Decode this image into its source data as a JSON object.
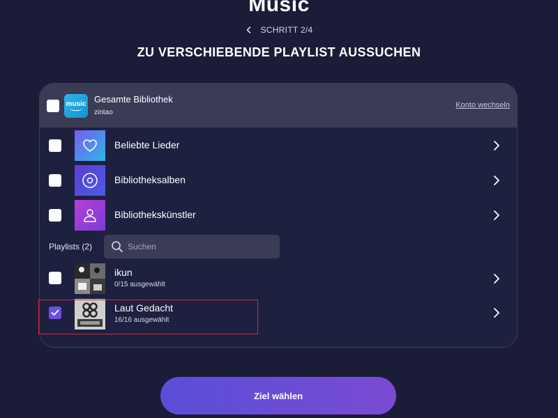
{
  "app_title": "Music",
  "step": {
    "label": "SCHRITT 2/4"
  },
  "heading": "ZU VERSCHIEBENDE PLAYLIST AUSSUCHEN",
  "library": {
    "title": "Gesamte Bibliothek",
    "account": "zintao",
    "logo_text": "music",
    "switch_label": "Konto wechseln",
    "checked": false
  },
  "categories": [
    {
      "label": "Beliebte Lieder",
      "icon": "heart-icon",
      "checked": false,
      "colors": [
        "#7a5cf0",
        "#2bb7e8"
      ]
    },
    {
      "label": "Bibliotheksalben",
      "icon": "disc-icon",
      "checked": false,
      "colors": [
        "#5a3fd0",
        "#4b5be6"
      ]
    },
    {
      "label": "Bibliothekskünstler",
      "icon": "person-icon",
      "checked": false,
      "colors": [
        "#b440d8",
        "#7a3cd6"
      ]
    }
  ],
  "playlists_section": {
    "label": "Playlists (2)",
    "search_placeholder": "Suchen"
  },
  "playlists": [
    {
      "name": "ikun",
      "count": "0/15 ausgewählt",
      "checked": false
    },
    {
      "name": "Laut Gedacht",
      "count": "16/16 ausgewählt",
      "checked": true
    }
  ],
  "cta": {
    "label": "Ziel wählen"
  },
  "colors": {
    "background": "#1b1c38",
    "card": "#1e2040",
    "header": "#3a3c56",
    "accent": "#6b4fe0",
    "highlight": "#d62a3a"
  }
}
